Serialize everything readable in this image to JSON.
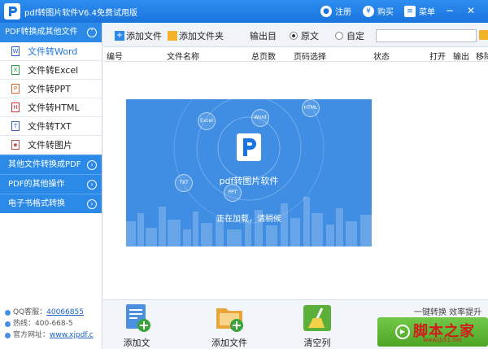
{
  "window": {
    "title": "pdf转图片软件V6.4免费试用版",
    "register": "注册",
    "buy": "购买",
    "menu": "菜单"
  },
  "sidebar": {
    "header": "PDF转换成其他文件",
    "items": [
      {
        "label": "文件转Word",
        "icon": "word-icon"
      },
      {
        "label": "文件转Excel",
        "icon": "excel-icon"
      },
      {
        "label": "文件转PPT",
        "icon": "ppt-icon"
      },
      {
        "label": "文件转HTML",
        "icon": "html-icon"
      },
      {
        "label": "文件转TXT",
        "icon": "txt-icon"
      },
      {
        "label": "文件转图片",
        "icon": "image-icon"
      }
    ],
    "sections": [
      "其他文件转换成PDF",
      "PDF的其他操作",
      "电子书格式转换"
    ],
    "qq_label": "QQ客服：",
    "qq_value": "40066855",
    "hotline_label": "热线：",
    "hotline_value": "400-668-5",
    "site_label": "官方网址：",
    "site_value": "www.xjpdf.c"
  },
  "toolbar": {
    "add_file": "添加文件",
    "add_folder": "添加文件夹",
    "output_dir": "输出目",
    "option_source": "原文",
    "option_custom": "自定",
    "path_value": ""
  },
  "table": {
    "headers": [
      "编号",
      "文件名称",
      "总页数",
      "页码选择",
      "状态",
      "打开",
      "输出",
      "移除"
    ]
  },
  "loading": {
    "title": "pdf转图片软件",
    "message": "正在加载，请稍候",
    "bubbles": [
      "Excel",
      "Word",
      "TXT",
      "PPT",
      "HTML"
    ]
  },
  "bottom": {
    "add_file": "添加文",
    "add_folder": "添加文件",
    "clear": "清空列",
    "one_click": "一键转换  效率提升",
    "watermark": "脚本之家",
    "watermark_url": "www.jb51.net"
  },
  "colors": {
    "accent": "#2b8ae8",
    "start": "#5cb531",
    "watermark": "#d21c1c"
  }
}
